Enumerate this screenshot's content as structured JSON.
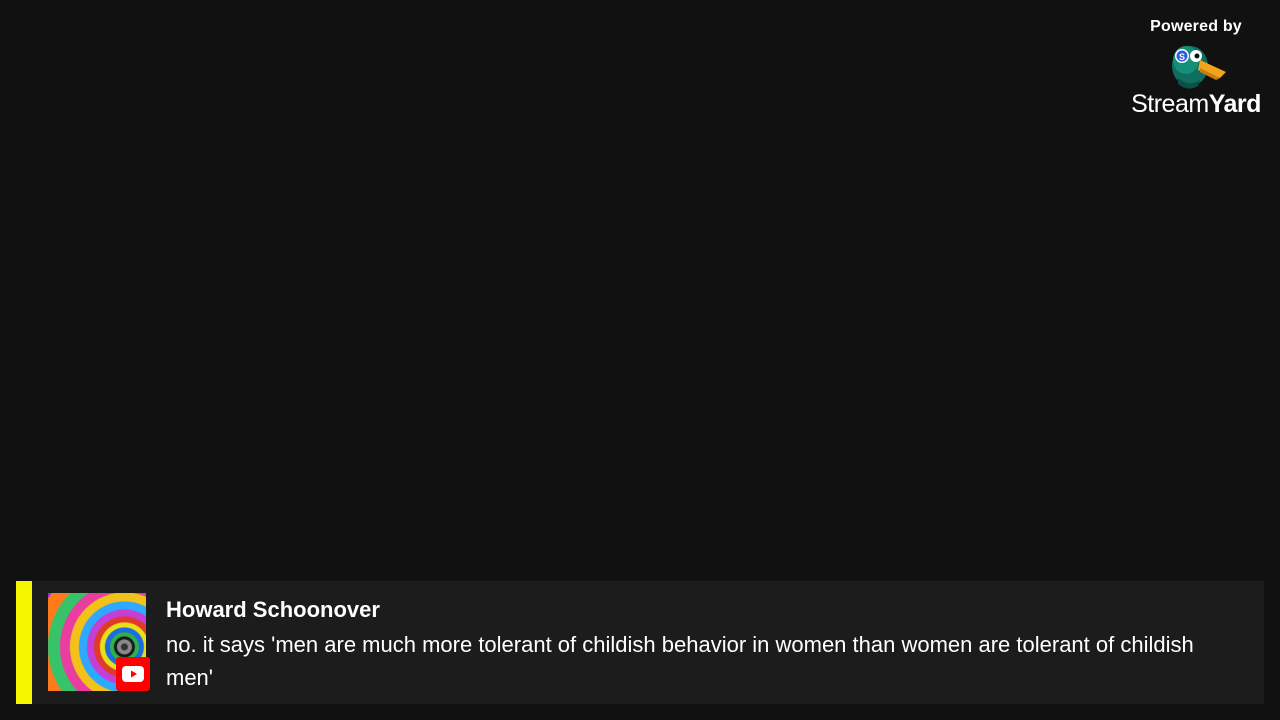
{
  "branding": {
    "powered_by": "Powered by",
    "logo_word_1": "Stream",
    "logo_word_2": "Yard",
    "logo_icon": "streamyard-duck-mascot-icon"
  },
  "comment": {
    "author": "Howard Schoonover",
    "message": "no. it says 'men are much more tolerant of childish behavior in women than women are tolerant of childish men'",
    "platform_icon": "youtube-icon",
    "accent_color": "#f6f600",
    "platform_color": "#ff0000"
  }
}
